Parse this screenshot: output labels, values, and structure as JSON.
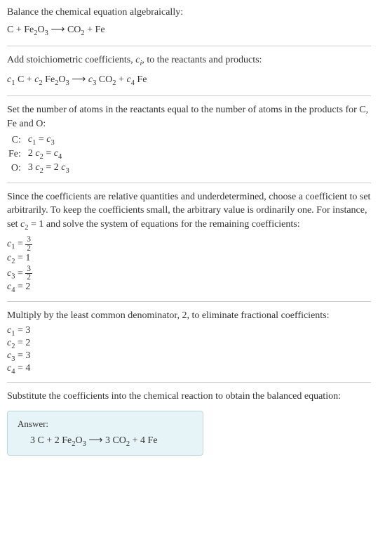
{
  "step1": {
    "title": "Balance the chemical equation algebraically:",
    "eq_pre_html": "C + Fe<span class='sub'>2</span>O<span class='sub'>3</span> <span class='arrow'>⟶</span> CO<span class='sub'>2</span> + Fe"
  },
  "step2": {
    "title_html": "Add stoichiometric coefficients, <span class='ital'>c<span class='sub'>i</span></span>, to the reactants and products:",
    "eq_html": "<span class='ital'>c</span><span class='sub'>1</span> C + <span class='ital'>c</span><span class='sub'>2</span> Fe<span class='sub'>2</span>O<span class='sub'>3</span> <span class='arrow'>⟶</span> <span class='ital'>c</span><span class='sub'>3</span> CO<span class='sub'>2</span> + <span class='ital'>c</span><span class='sub'>4</span> Fe"
  },
  "step3": {
    "title": "Set the number of atoms in the reactants equal to the number of atoms in the products for C, Fe and O:",
    "rows": [
      {
        "label": "C:",
        "eq_html": "<span class='ital'>c</span><span class='sub'>1</span> = <span class='ital'>c</span><span class='sub'>3</span>"
      },
      {
        "label": "Fe:",
        "eq_html": "2 <span class='ital'>c</span><span class='sub'>2</span> = <span class='ital'>c</span><span class='sub'>4</span>"
      },
      {
        "label": "O:",
        "eq_html": "3 <span class='ital'>c</span><span class='sub'>2</span> = 2 <span class='ital'>c</span><span class='sub'>3</span>"
      }
    ]
  },
  "step4": {
    "title_html": "Since the coefficients are relative quantities and underdetermined, choose a coefficient to set arbitrarily. To keep the coefficients small, the arbitrary value is ordinarily one. For instance, set <span class='ital'>c</span><span class='sub'>2</span> = 1 and solve the system of equations for the remaining coefficients:",
    "rows": [
      {
        "eq_html": "<span class='ital'>c</span><span class='sub'>1</span> = <span class='frac'><span class='num'>3</span><span class='den'>2</span></span>"
      },
      {
        "eq_html": "<span class='ital'>c</span><span class='sub'>2</span> = 1"
      },
      {
        "eq_html": "<span class='ital'>c</span><span class='sub'>3</span> = <span class='frac'><span class='num'>3</span><span class='den'>2</span></span>"
      },
      {
        "eq_html": "<span class='ital'>c</span><span class='sub'>4</span> = 2"
      }
    ]
  },
  "step5": {
    "title": "Multiply by the least common denominator, 2, to eliminate fractional coefficients:",
    "rows": [
      {
        "eq_html": "<span class='ital'>c</span><span class='sub'>1</span> = 3"
      },
      {
        "eq_html": "<span class='ital'>c</span><span class='sub'>2</span> = 2"
      },
      {
        "eq_html": "<span class='ital'>c</span><span class='sub'>3</span> = 3"
      },
      {
        "eq_html": "<span class='ital'>c</span><span class='sub'>4</span> = 4"
      }
    ]
  },
  "step6": {
    "title": "Substitute the coefficients into the chemical reaction to obtain the balanced equation:"
  },
  "answer": {
    "label": "Answer:",
    "eq_html": "3 C + 2 Fe<span class='sub'>2</span>O<span class='sub'>3</span> <span class='arrow'>⟶</span> 3 CO<span class='sub'>2</span> + 4 Fe"
  }
}
